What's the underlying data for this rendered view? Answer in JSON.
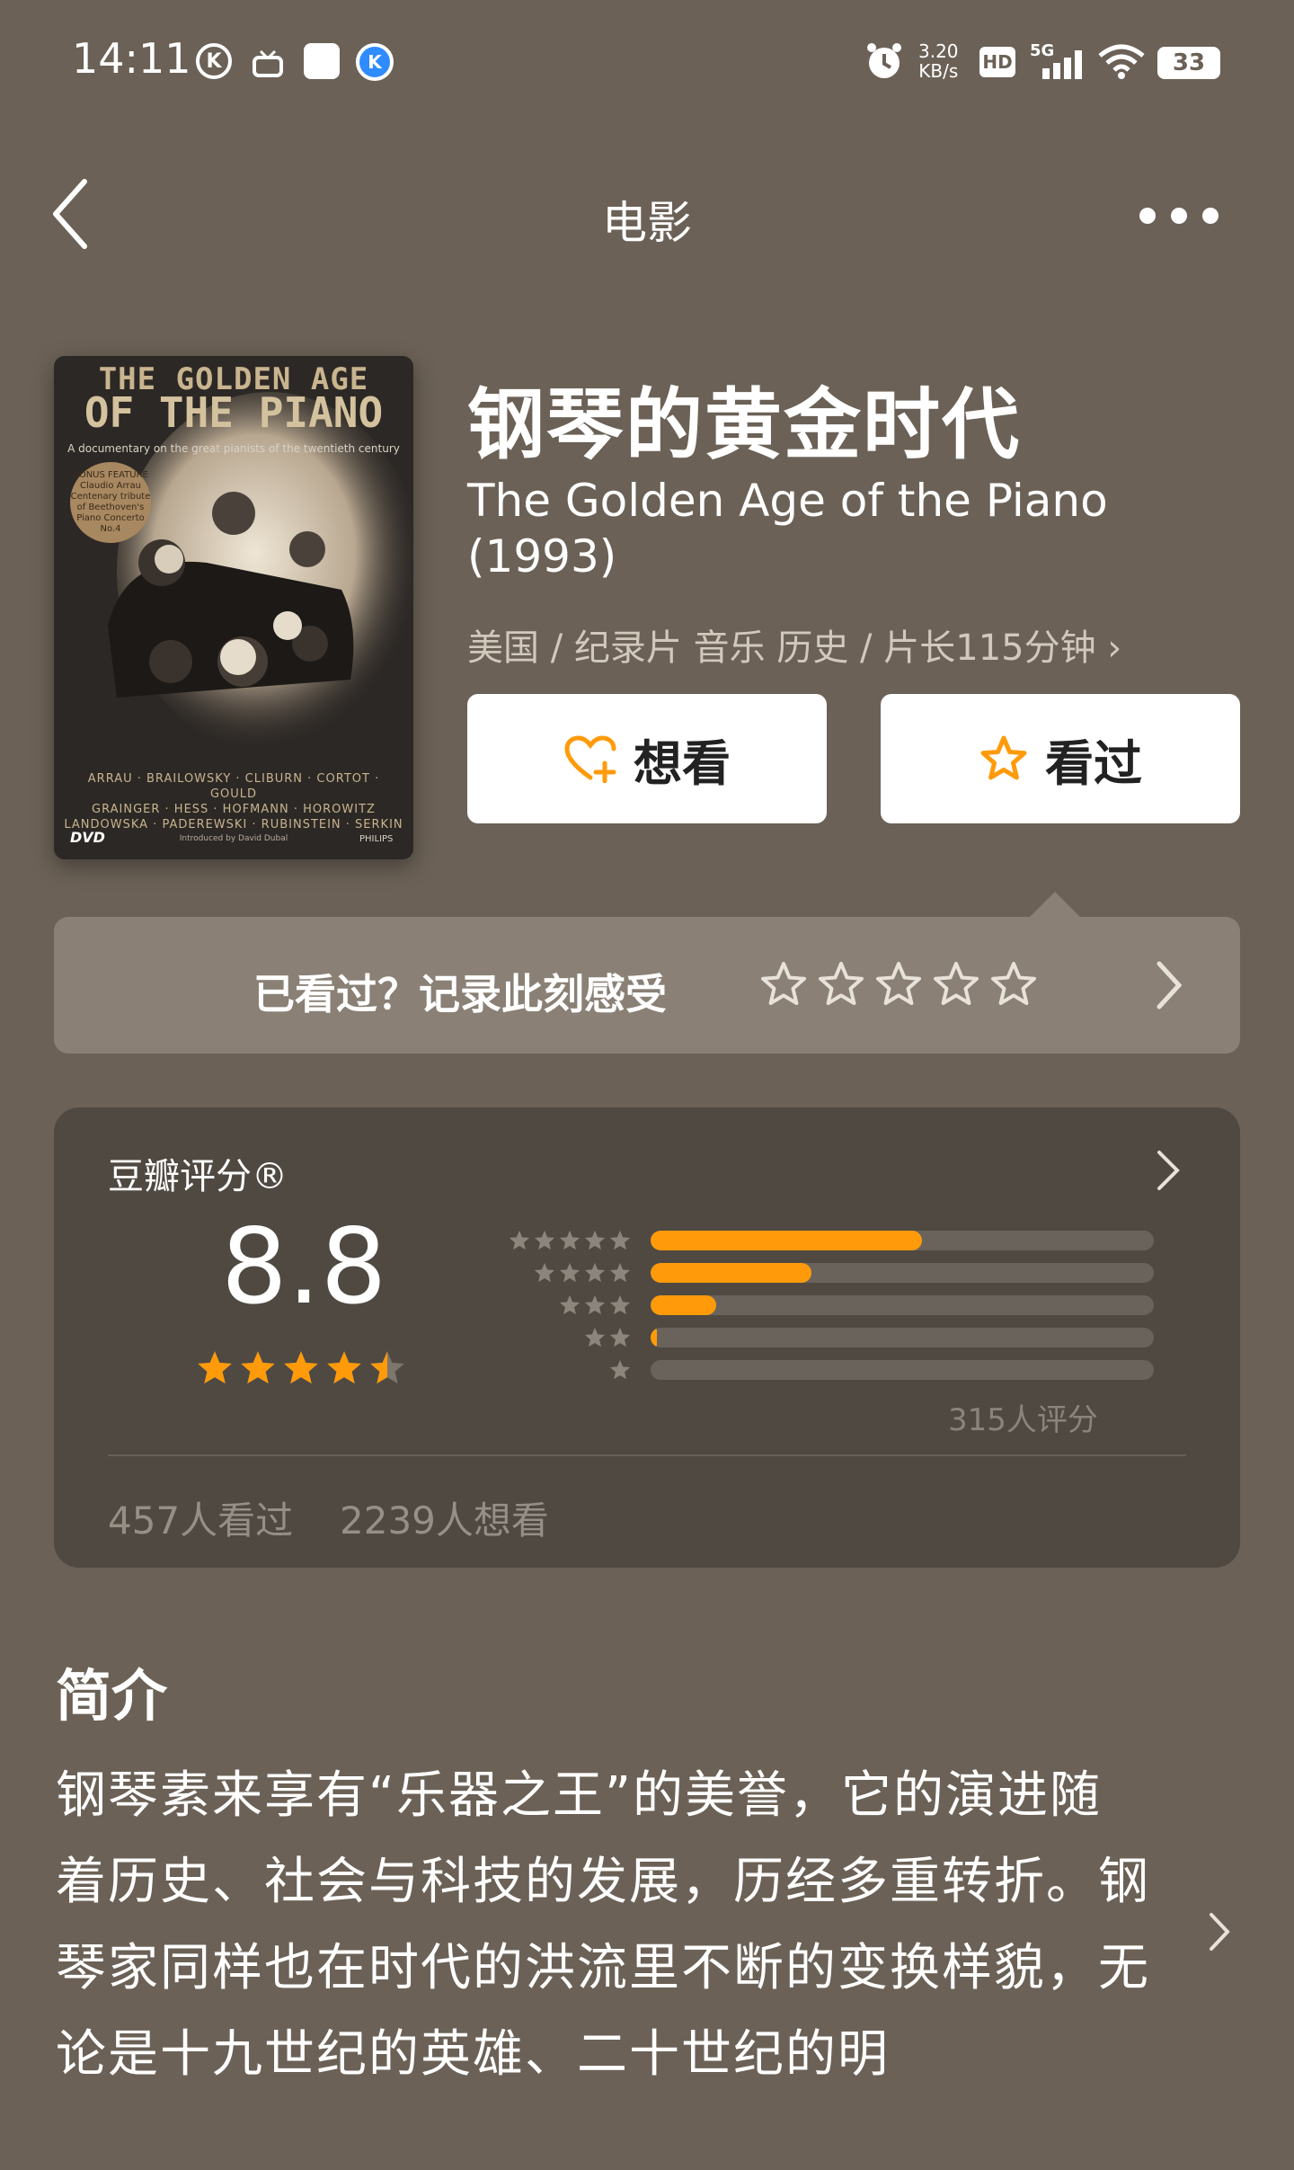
{
  "status_bar": {
    "time": "14:11",
    "net_speed_value": "3.20",
    "net_speed_unit": "KB/s",
    "hd": "HD",
    "signal": "5G",
    "battery": "33",
    "icons": [
      "k-icon",
      "tv-icon",
      "square-icon",
      "k-blue-icon",
      "alarm-icon",
      "signal-icon",
      "wifi-icon",
      "battery-icon"
    ]
  },
  "nav": {
    "title": "电影"
  },
  "poster": {
    "line1": "THE GOLDEN AGE",
    "line2": "OF THE PIANO",
    "subtitle": "A documentary on the great pianists of the twentieth century",
    "badge": "BONUS FEATURE Claudio Arrau Centenary tribute of Beethoven's Piano Concerto No.4",
    "names_1": "ARRAU · BRAILOWSKY · CLIBURN · CORTOT · GOULD",
    "names_2": "GRAINGER · HESS · HOFMANN · HOROWITZ",
    "names_3": "LANDOWSKA · PADEREWSKI · RUBINSTEIN · SERKIN",
    "dvd": "DVD",
    "intro": "Introduced by David Dubal",
    "label": "PHILIPS"
  },
  "movie": {
    "title_cn": "钢琴的黄金时代",
    "title_en": "The Golden Age of the Piano (1993)",
    "meta": "美国 / 纪录片 音乐 历史 / 片长115分钟 ›"
  },
  "actions": {
    "want_label": "想看",
    "seen_label": "看过"
  },
  "record": {
    "prompt": "已看过？记录此刻感受"
  },
  "rating": {
    "label": "豆瓣评分®",
    "score": "8.8",
    "score_stars": 4.5,
    "distribution": [
      {
        "stars": 5,
        "fraction": 0.54
      },
      {
        "stars": 4,
        "fraction": 0.32
      },
      {
        "stars": 3,
        "fraction": 0.13
      },
      {
        "stars": 2,
        "fraction": 0.01
      },
      {
        "stars": 1,
        "fraction": 0.0
      }
    ],
    "count_text": "315人评分",
    "seen_text": "457人看过",
    "want_text": "2239人想看"
  },
  "synopsis": {
    "title": "简介",
    "text": "钢琴素来享有“乐器之王”的美誉，它的演进随着历史、社会与科技的发展，历经多重转折。钢琴家同样也在时代的洪流里不断的变换样貌，无论是十九世纪的英雄、二十世纪的明"
  },
  "colors": {
    "background": "#6b6156",
    "card": "#4f4942",
    "accent": "#ff9b0a",
    "record_bar": "#8a8075"
  }
}
